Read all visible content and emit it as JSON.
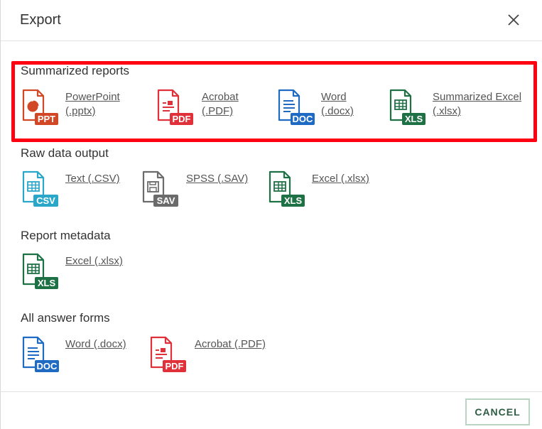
{
  "dialog": {
    "title": "Export",
    "cancel_label": "CANCEL"
  },
  "colors": {
    "ppt": "#d24726",
    "pdf": "#e0313a",
    "doc": "#1f6ac2",
    "xls": "#1e7145",
    "csv": "#2aa7c8",
    "sav": "#6b6b6b",
    "highlight": "#ff0012"
  },
  "sections": {
    "summarized": {
      "title": "Summarized reports",
      "items": [
        {
          "icon": "powerpoint-file-icon",
          "badge": "PPT",
          "label": "PowerPoint\n(.pptx)"
        },
        {
          "icon": "pdf-file-icon",
          "badge": "PDF",
          "label": "Acrobat\n(.PDF)"
        },
        {
          "icon": "word-file-icon",
          "badge": "DOC",
          "label": "Word\n(.docx)"
        },
        {
          "icon": "excel-file-icon",
          "badge": "XLS",
          "label": "Summarized Excel\n(.xlsx)"
        }
      ]
    },
    "raw": {
      "title": "Raw data output",
      "items": [
        {
          "icon": "csv-file-icon",
          "badge": "CSV",
          "label": "Text (.CSV)"
        },
        {
          "icon": "spss-file-icon",
          "badge": "SAV",
          "label": "SPSS (.SAV)"
        },
        {
          "icon": "excel-file-icon",
          "badge": "XLS",
          "label": "Excel (.xlsx)"
        }
      ]
    },
    "metadata": {
      "title": "Report metadata",
      "items": [
        {
          "icon": "excel-file-icon",
          "badge": "XLS",
          "label": "Excel (.xlsx)"
        }
      ]
    },
    "answer_forms": {
      "title": "All answer forms",
      "items": [
        {
          "icon": "word-file-icon",
          "badge": "DOC",
          "label": "Word (.docx)"
        },
        {
          "icon": "pdf-file-icon",
          "badge": "PDF",
          "label": "Acrobat (.PDF)"
        }
      ]
    }
  }
}
